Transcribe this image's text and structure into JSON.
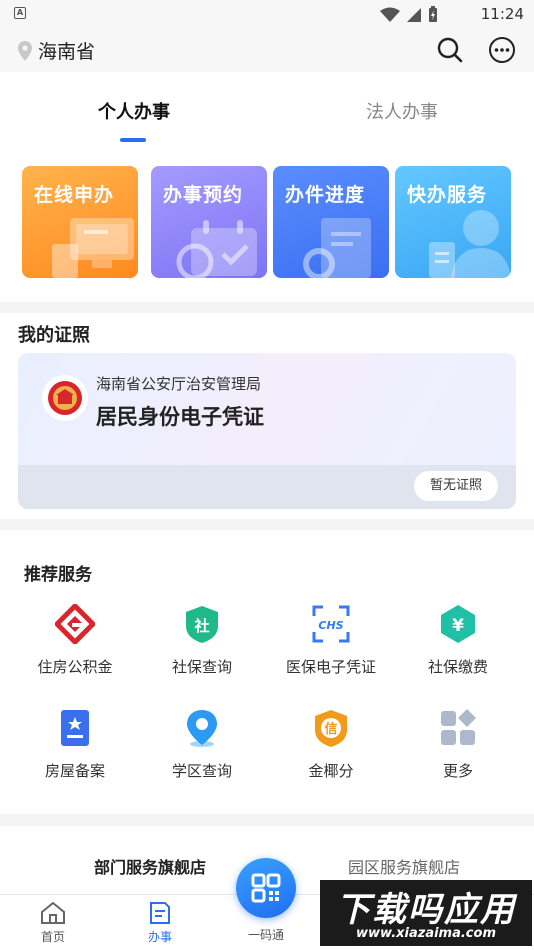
{
  "status_bar": {
    "time": "11:24",
    "notification_letter": "A"
  },
  "header": {
    "location": "海南省"
  },
  "tabs": [
    {
      "label": "个人办事",
      "active": true
    },
    {
      "label": "法人办事",
      "active": false
    }
  ],
  "tiles": [
    {
      "label": "在线申办",
      "color": "#ff9a2e"
    },
    {
      "label": "办事预约",
      "color": "#8c84f8"
    },
    {
      "label": "办件进度",
      "color": "#467cf6"
    },
    {
      "label": "快办服务",
      "color": "#4ab4f8"
    }
  ],
  "certificates": {
    "title": "我的证照",
    "card": {
      "org": "海南省公安厅治安管理局",
      "name": "居民身份电子凭证",
      "status_button": "暂无证照"
    }
  },
  "recommended": {
    "title": "推荐服务",
    "items": [
      {
        "label": "住房公积金",
        "icon": "housing-fund-icon"
      },
      {
        "label": "社保查询",
        "icon": "social-security-query-icon",
        "glyph": "社"
      },
      {
        "label": "医保电子凭证",
        "icon": "medical-insurance-icon",
        "glyph": "CHS"
      },
      {
        "label": "社保缴费",
        "icon": "social-security-payment-icon",
        "glyph": "¥"
      },
      {
        "label": "房屋备案",
        "icon": "house-record-icon"
      },
      {
        "label": "学区查询",
        "icon": "school-district-icon"
      },
      {
        "label": "金椰分",
        "icon": "coconut-score-icon",
        "glyph": "信"
      },
      {
        "label": "更多",
        "icon": "more-grid-icon"
      }
    ]
  },
  "flagship": {
    "dept": "部门服务旗舰店",
    "park": "园区服务旗舰店"
  },
  "bottom_nav": {
    "home": "首页",
    "services": "办事",
    "qr": "一码通"
  },
  "watermark": {
    "top": "下载吗应用",
    "bottom": "www.xiazaima.com"
  },
  "colors": {
    "accent": "#2b6ef6",
    "red": "#d8262d",
    "green": "#1fb98a",
    "blue": "#3a78f0",
    "orange": "#f29a1a"
  }
}
